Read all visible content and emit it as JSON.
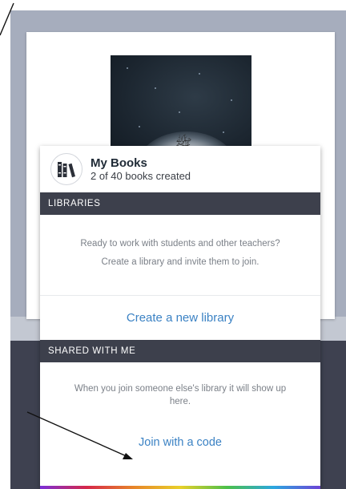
{
  "header": {
    "title": "My Books",
    "subtitle": "2 of 40 books created",
    "icon": "bookshelf-icon"
  },
  "libraries": {
    "section_label": "LIBRARIES",
    "message_line1": "Ready to work with students and other teachers?",
    "message_line2": "Create a library and invite them to join.",
    "action_label": "Create a new library"
  },
  "shared": {
    "section_label": "SHARED WITH ME",
    "message": "When you join someone else's library it will show up here.",
    "action_label": "Join with a code"
  },
  "cover": {
    "glyph": "ﷺ"
  },
  "colors": {
    "section_bar": "#3d404c",
    "action_link": "#3b82c4",
    "title_text": "#1f2a36",
    "background_dark": "#3e4150",
    "background_light": "#a6adbd"
  }
}
